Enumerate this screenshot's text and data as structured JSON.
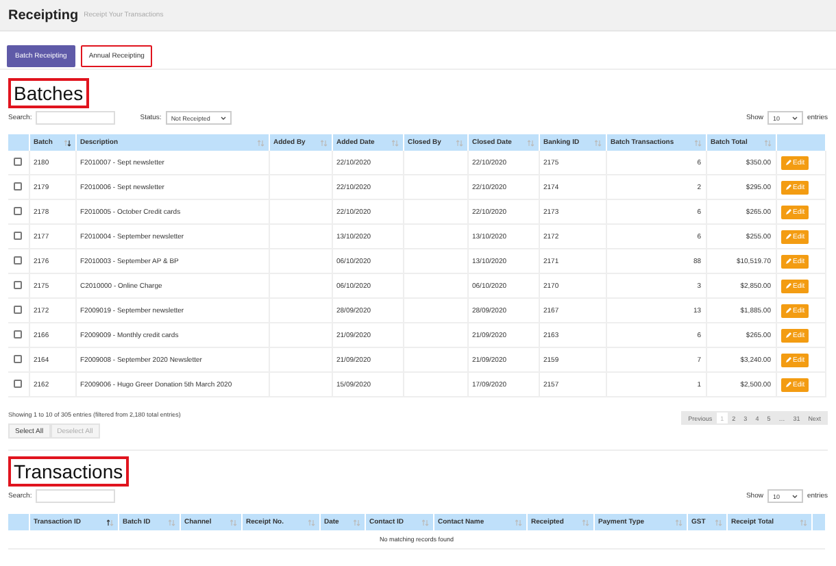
{
  "header": {
    "title": "Receipting",
    "subtitle": "Receipt Your Transactions"
  },
  "tabs": [
    {
      "label": "Batch Receipting",
      "selected": true,
      "annotated": false
    },
    {
      "label": "Annual Receipting",
      "selected": false,
      "annotated": true
    }
  ],
  "batches": {
    "heading": "Batches",
    "annotated": true,
    "search": {
      "label": "Search:"
    },
    "status": {
      "label": "Status:",
      "value": "Not Receipted"
    },
    "show": {
      "label": "Show",
      "value": "10",
      "suffix": "entries"
    },
    "columns": [
      {
        "label": "Batch",
        "sorted_ascending": false,
        "sorted_descending": true
      },
      {
        "label": "Description",
        "sorted_ascending": false,
        "sorted_descending": false
      },
      {
        "label": "Added By",
        "sorted_ascending": false,
        "sorted_descending": false
      },
      {
        "label": "Added Date",
        "sorted_ascending": false,
        "sorted_descending": false
      },
      {
        "label": "Closed By",
        "sorted_ascending": false,
        "sorted_descending": false
      },
      {
        "label": "Closed Date",
        "sorted_ascending": false,
        "sorted_descending": false
      },
      {
        "label": "Banking ID",
        "sorted_ascending": false,
        "sorted_descending": false
      },
      {
        "label": "Batch Transactions",
        "sorted_ascending": false,
        "sorted_descending": false
      },
      {
        "label": "Batch Total",
        "sorted_ascending": false,
        "sorted_descending": false
      }
    ],
    "rows": [
      {
        "checked": false,
        "cells": [
          "2180",
          "F2010007 - Sept newsletter",
          "",
          "22/10/2020",
          "",
          "22/10/2020",
          "2175",
          "6",
          "$350.00"
        ],
        "action": "Edit"
      },
      {
        "checked": false,
        "cells": [
          "2179",
          "F2010006 - Sept newsletter",
          "",
          "22/10/2020",
          "",
          "22/10/2020",
          "2174",
          "2",
          "$295.00"
        ],
        "action": "Edit"
      },
      {
        "checked": false,
        "cells": [
          "2178",
          "F2010005 - October Credit cards",
          "",
          "22/10/2020",
          "",
          "22/10/2020",
          "2173",
          "6",
          "$265.00"
        ],
        "action": "Edit"
      },
      {
        "checked": false,
        "cells": [
          "2177",
          "F2010004 - September newsletter",
          "",
          "13/10/2020",
          "",
          "13/10/2020",
          "2172",
          "6",
          "$255.00"
        ],
        "action": "Edit"
      },
      {
        "checked": false,
        "cells": [
          "2176",
          "F2010003 - September AP & BP",
          "",
          "06/10/2020",
          "",
          "13/10/2020",
          "2171",
          "88",
          "$10,519.70"
        ],
        "action": "Edit"
      },
      {
        "checked": false,
        "cells": [
          "2175",
          "C2010000 - Online Charge",
          "",
          "06/10/2020",
          "",
          "06/10/2020",
          "2170",
          "3",
          "$2,850.00"
        ],
        "action": "Edit"
      },
      {
        "checked": false,
        "cells": [
          "2172",
          "F2009019 - September newsletter",
          "",
          "28/09/2020",
          "",
          "28/09/2020",
          "2167",
          "13",
          "$1,885.00"
        ],
        "action": "Edit"
      },
      {
        "checked": false,
        "cells": [
          "2166",
          "F2009009 - Monthly credit cards",
          "",
          "21/09/2020",
          "",
          "21/09/2020",
          "2163",
          "6",
          "$265.00"
        ],
        "action": "Edit"
      },
      {
        "checked": false,
        "cells": [
          "2164",
          "F2009008 - September 2020 Newsletter",
          "",
          "21/09/2020",
          "",
          "21/09/2020",
          "2159",
          "7",
          "$3,240.00"
        ],
        "action": "Edit"
      },
      {
        "checked": false,
        "cells": [
          "2162",
          "F2009006 - Hugo Greer Donation 5th March 2020",
          "",
          "15/09/2020",
          "",
          "17/09/2020",
          "2157",
          "1",
          "$2,500.00"
        ],
        "action": "Edit"
      }
    ],
    "info": "Showing 1 to 10 of 305 entries (filtered from 2,180 total entries)",
    "buttons": [
      {
        "label": "Select All",
        "disabled": false
      },
      {
        "label": "Deselect All",
        "disabled": true
      }
    ],
    "pagination": [
      {
        "label": "Previous",
        "selected": false
      },
      {
        "label": "1",
        "selected": true
      },
      {
        "label": "2",
        "selected": false
      },
      {
        "label": "3",
        "selected": false
      },
      {
        "label": "4",
        "selected": false
      },
      {
        "label": "5",
        "selected": false
      },
      {
        "label": "…",
        "selected": false
      },
      {
        "label": "31",
        "selected": false
      },
      {
        "label": "Next",
        "selected": false
      }
    ]
  },
  "transactions": {
    "heading": "Transactions",
    "annotated": true,
    "search": {
      "label": "Search:"
    },
    "show": {
      "label": "Show",
      "value": "10",
      "suffix": "entries"
    },
    "columns": [
      {
        "label": "Transaction ID",
        "sorted_ascending": true,
        "sorted_descending": false
      },
      {
        "label": "Batch ID",
        "sorted_ascending": false,
        "sorted_descending": false
      },
      {
        "label": "Channel",
        "sorted_ascending": false,
        "sorted_descending": false
      },
      {
        "label": "Receipt No.",
        "sorted_ascending": false,
        "sorted_descending": false
      },
      {
        "label": "Date",
        "sorted_ascending": false,
        "sorted_descending": false
      },
      {
        "label": "Contact ID",
        "sorted_ascending": false,
        "sorted_descending": false
      },
      {
        "label": "Contact Name",
        "sorted_ascending": false,
        "sorted_descending": false
      },
      {
        "label": "Receipted",
        "sorted_ascending": false,
        "sorted_descending": false
      },
      {
        "label": "Payment Type",
        "sorted_ascending": false,
        "sorted_descending": false
      },
      {
        "label": "GST",
        "sorted_ascending": false,
        "sorted_descending": false
      },
      {
        "label": "Receipt Total",
        "sorted_ascending": false,
        "sorted_descending": false
      }
    ],
    "empty": "No matching records found"
  }
}
